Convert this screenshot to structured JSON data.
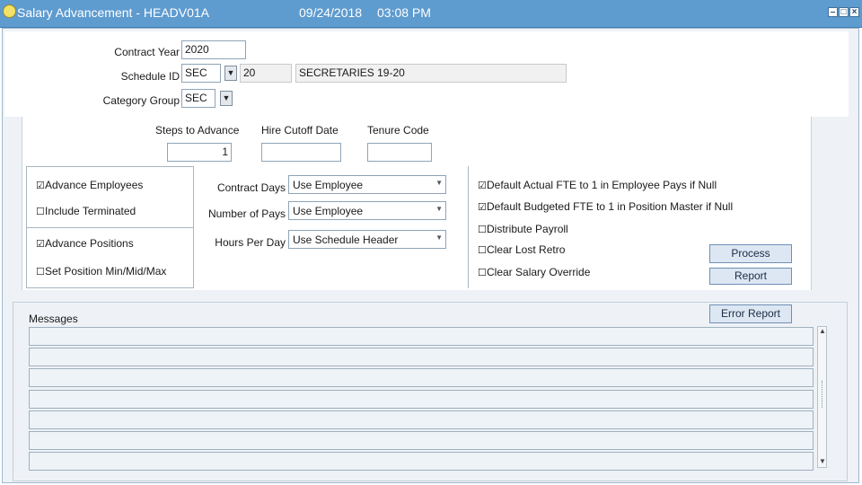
{
  "window": {
    "title": "Salary Advancement - HEADV01A",
    "date": "09/24/2018",
    "time": "03:08 PM",
    "controls": [
      "minimize-icon",
      "maximize-icon",
      "close-icon"
    ]
  },
  "header": {
    "contract_year_label": "Contract Year",
    "contract_year_value": "2020",
    "schedule_id_label": "Schedule ID",
    "schedule_id_value": "SEC",
    "schedule_num_value": "20",
    "schedule_desc_value": "SECRETARIES 19-20",
    "category_group_label": "Category Group",
    "category_group_value": "SEC"
  },
  "advance": {
    "steps_label": "Steps to Advance",
    "steps_value": "1",
    "hire_cutoff_label": "Hire Cutoff Date",
    "hire_cutoff_value": "",
    "tenure_label": "Tenure Code",
    "tenure_value": ""
  },
  "left_options": {
    "advance_employees": {
      "label": "Advance Employees",
      "checked": true
    },
    "include_terminated": {
      "label": "Include Terminated",
      "checked": false
    },
    "advance_positions": {
      "label": "Advance Positions",
      "checked": true
    },
    "set_position_minmidmax": {
      "label": "Set Position Min/Mid/Max",
      "checked": false
    }
  },
  "middle": {
    "contract_days_label": "Contract Days",
    "contract_days_value": "Use Employee",
    "num_pays_label": "Number of Pays",
    "num_pays_value": "Use Employee",
    "hours_per_day_label": "Hours Per Day",
    "hours_per_day_value": "Use Schedule Header"
  },
  "right_options": {
    "default_actual_fte": {
      "label": "Default Actual FTE to 1 in Employee Pays if Null",
      "checked": true
    },
    "default_budgeted_fte": {
      "label": "Default Budgeted FTE to 1 in Position Master if Null",
      "checked": true
    },
    "distribute_payroll": {
      "label": "Distribute Payroll",
      "checked": false
    },
    "clear_lost_retro": {
      "label": "Clear Lost Retro",
      "checked": false
    },
    "clear_salary_override": {
      "label": "Clear Salary Override",
      "checked": false
    }
  },
  "buttons": {
    "process": "Process",
    "report": "Report",
    "error_report": "Error Report"
  },
  "messages": {
    "label": "Messages",
    "rows": [
      "",
      "",
      "",
      "",
      "",
      "",
      ""
    ]
  },
  "glyphs": {
    "checked": "☑",
    "unchecked": "☐",
    "dropdown": "▼"
  }
}
